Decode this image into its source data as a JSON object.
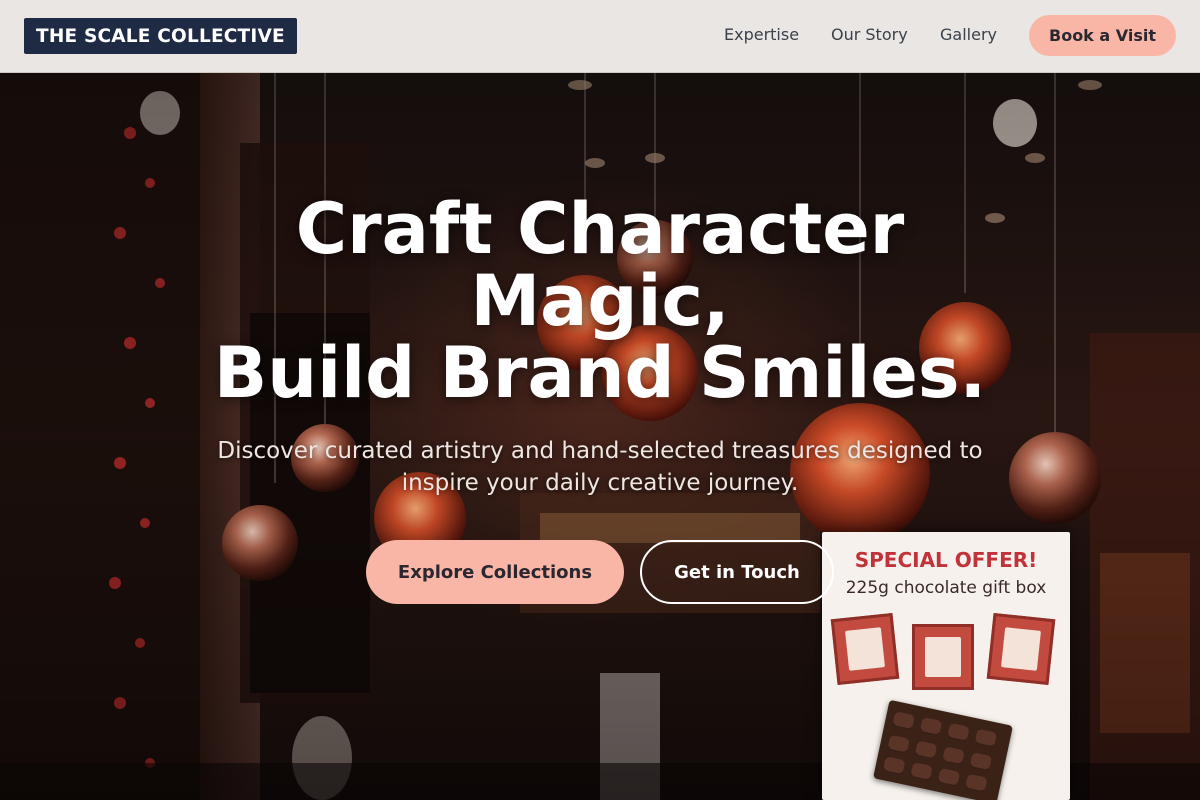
{
  "header": {
    "logo": "THE SCALE COLLECTIVE",
    "nav": [
      {
        "label": "Expertise"
      },
      {
        "label": "Our Story"
      },
      {
        "label": "Gallery"
      }
    ],
    "cta_label": "Book a Visit"
  },
  "hero": {
    "title_lines": [
      "Craft Character",
      "Magic,",
      "Build Brand Smiles."
    ],
    "subtitle": "Discover curated artistry and hand-selected treasures designed to inspire your daily creative journey.",
    "primary_button": "Explore Collections",
    "secondary_button": "Get in Touch"
  },
  "background": {
    "offer_sign": {
      "title": "SPECIAL OFFER!",
      "subtitle": "225g chocolate gift box"
    }
  },
  "colors": {
    "brand_navy": "#1f2a44",
    "accent_peach": "#f9b6a6",
    "header_bg": "#e9e6e3",
    "offer_red": "#c2323a"
  }
}
